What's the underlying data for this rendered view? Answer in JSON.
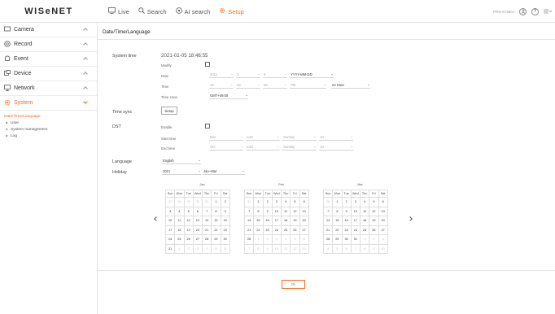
{
  "brand": {
    "logo": "WISeNET",
    "accent": "#f06b24"
  },
  "topnav": [
    {
      "label": "Live",
      "icon": "monitor-icon",
      "active": false
    },
    {
      "label": "Search",
      "icon": "search-icon",
      "active": false
    },
    {
      "label": "AI search",
      "icon": "ai-search-icon",
      "active": false
    },
    {
      "label": "Setup",
      "icon": "gear-icon",
      "active": true
    }
  ],
  "topright": {
    "model": "PRN-5?280J"
  },
  "sidebar": {
    "items": [
      {
        "label": "Camera",
        "icon": "camera-icon"
      },
      {
        "label": "Record",
        "icon": "record-icon"
      },
      {
        "label": "Event",
        "icon": "bell-icon"
      },
      {
        "label": "Device",
        "icon": "device-icon"
      },
      {
        "label": "Network",
        "icon": "network-icon"
      },
      {
        "label": "System",
        "icon": "gear-icon"
      }
    ],
    "sub": [
      {
        "label": "Date/Time/Language",
        "active": true
      },
      {
        "label": "User",
        "active": false
      },
      {
        "label": "System management",
        "active": false
      },
      {
        "label": "Log",
        "active": false
      }
    ]
  },
  "page": {
    "title": "Date/Time/Language"
  },
  "system_time": {
    "label": "System time",
    "value": "2021-01-05 18:46:55",
    "modify_label": "Modify",
    "date_label": "Date",
    "date_year": "2021",
    "date_month": "1",
    "date_day": "5",
    "date_format": "YYYY-MM-DD",
    "time_label": "Time",
    "time_hour": "18",
    "time_min": "46",
    "time_sec": "58",
    "time_ampm": "PM",
    "time_format": "24 Hour",
    "timezone_label": "Time zone",
    "timezone": "GMT+09:00"
  },
  "time_sync": {
    "label": "Time sync",
    "button": "Setup"
  },
  "dst": {
    "label": "DST",
    "enable_label": "Enable",
    "start_label": "Start time",
    "end_label": "End time",
    "start": [
      "Mar",
      "Last",
      "Sunday",
      "1H"
    ],
    "end": [
      "Oct",
      "Last",
      "Sunday",
      "1H"
    ]
  },
  "language": {
    "label": "Language",
    "value": "English"
  },
  "holiday": {
    "label": "Holiday",
    "year": "2021",
    "range": "Jan~Mar"
  },
  "calendar": {
    "weekdays": [
      "Sun",
      "Mon",
      "Tue",
      "Wed",
      "Thu",
      "Fri",
      "Sat"
    ],
    "months": [
      {
        "name": "Jan",
        "weeks": [
          [
            [
              "27",
              1
            ],
            [
              "28",
              1
            ],
            [
              "29",
              1
            ],
            [
              "30",
              1
            ],
            [
              "31",
              1
            ],
            [
              "1",
              0
            ],
            [
              "2",
              0
            ]
          ],
          [
            [
              "3",
              0
            ],
            [
              "4",
              0
            ],
            [
              "5",
              0
            ],
            [
              "6",
              0
            ],
            [
              "7",
              0
            ],
            [
              "8",
              0
            ],
            [
              "9",
              0
            ]
          ],
          [
            [
              "10",
              0
            ],
            [
              "11",
              0
            ],
            [
              "12",
              0
            ],
            [
              "13",
              0
            ],
            [
              "14",
              0
            ],
            [
              "15",
              0
            ],
            [
              "16",
              0
            ]
          ],
          [
            [
              "17",
              0
            ],
            [
              "18",
              0
            ],
            [
              "19",
              0
            ],
            [
              "20",
              0
            ],
            [
              "21",
              0
            ],
            [
              "22",
              0
            ],
            [
              "23",
              0
            ]
          ],
          [
            [
              "24",
              0
            ],
            [
              "25",
              0
            ],
            [
              "26",
              0
            ],
            [
              "27",
              0
            ],
            [
              "28",
              0
            ],
            [
              "29",
              0
            ],
            [
              "30",
              0
            ]
          ],
          [
            [
              "31",
              0
            ],
            [
              "1",
              1
            ],
            [
              "2",
              1
            ],
            [
              "3",
              1
            ],
            [
              "4",
              1
            ],
            [
              "5",
              1
            ],
            [
              "6",
              1
            ]
          ]
        ]
      },
      {
        "name": "Feb",
        "weeks": [
          [
            [
              "31",
              1
            ],
            [
              "1",
              0
            ],
            [
              "2",
              0
            ],
            [
              "3",
              0
            ],
            [
              "4",
              0
            ],
            [
              "5",
              0
            ],
            [
              "6",
              0
            ]
          ],
          [
            [
              "7",
              0
            ],
            [
              "8",
              0
            ],
            [
              "9",
              0
            ],
            [
              "10",
              0
            ],
            [
              "11",
              0
            ],
            [
              "12",
              0
            ],
            [
              "13",
              0
            ]
          ],
          [
            [
              "14",
              0
            ],
            [
              "15",
              0
            ],
            [
              "16",
              0
            ],
            [
              "17",
              0
            ],
            [
              "18",
              0
            ],
            [
              "19",
              0
            ],
            [
              "20",
              0
            ]
          ],
          [
            [
              "21",
              0
            ],
            [
              "22",
              0
            ],
            [
              "23",
              0
            ],
            [
              "24",
              0
            ],
            [
              "25",
              0
            ],
            [
              "26",
              0
            ],
            [
              "27",
              0
            ]
          ],
          [
            [
              "28",
              0
            ],
            [
              "1",
              1
            ],
            [
              "2",
              1
            ],
            [
              "3",
              1
            ],
            [
              "4",
              1
            ],
            [
              "5",
              1
            ],
            [
              "6",
              1
            ]
          ],
          [
            [
              "7",
              1
            ],
            [
              "8",
              1
            ],
            [
              "9",
              1
            ],
            [
              "10",
              1
            ],
            [
              "11",
              1
            ],
            [
              "12",
              1
            ],
            [
              "13",
              1
            ]
          ]
        ]
      },
      {
        "name": "Mar",
        "weeks": [
          [
            [
              "28",
              1
            ],
            [
              "1",
              0
            ],
            [
              "2",
              0
            ],
            [
              "3",
              0
            ],
            [
              "4",
              0
            ],
            [
              "5",
              0
            ],
            [
              "6",
              0
            ]
          ],
          [
            [
              "7",
              0
            ],
            [
              "8",
              0
            ],
            [
              "9",
              0
            ],
            [
              "10",
              0
            ],
            [
              "11",
              0
            ],
            [
              "12",
              0
            ],
            [
              "13",
              0
            ]
          ],
          [
            [
              "14",
              0
            ],
            [
              "15",
              0
            ],
            [
              "16",
              0
            ],
            [
              "17",
              0
            ],
            [
              "18",
              0
            ],
            [
              "19",
              0
            ],
            [
              "20",
              0
            ]
          ],
          [
            [
              "21",
              0
            ],
            [
              "22",
              0
            ],
            [
              "23",
              0
            ],
            [
              "24",
              0
            ],
            [
              "25",
              0
            ],
            [
              "26",
              0
            ],
            [
              "27",
              0
            ]
          ],
          [
            [
              "28",
              0
            ],
            [
              "29",
              0
            ],
            [
              "30",
              0
            ],
            [
              "31",
              0
            ],
            [
              "1",
              1
            ],
            [
              "2",
              1
            ],
            [
              "3",
              1
            ]
          ],
          [
            [
              "4",
              1
            ],
            [
              "5",
              1
            ],
            [
              "6",
              1
            ],
            [
              "7",
              1
            ],
            [
              "8",
              1
            ],
            [
              "9",
              1
            ],
            [
              "10",
              1
            ]
          ]
        ]
      }
    ]
  },
  "footer": {
    "ok": "Ok"
  }
}
